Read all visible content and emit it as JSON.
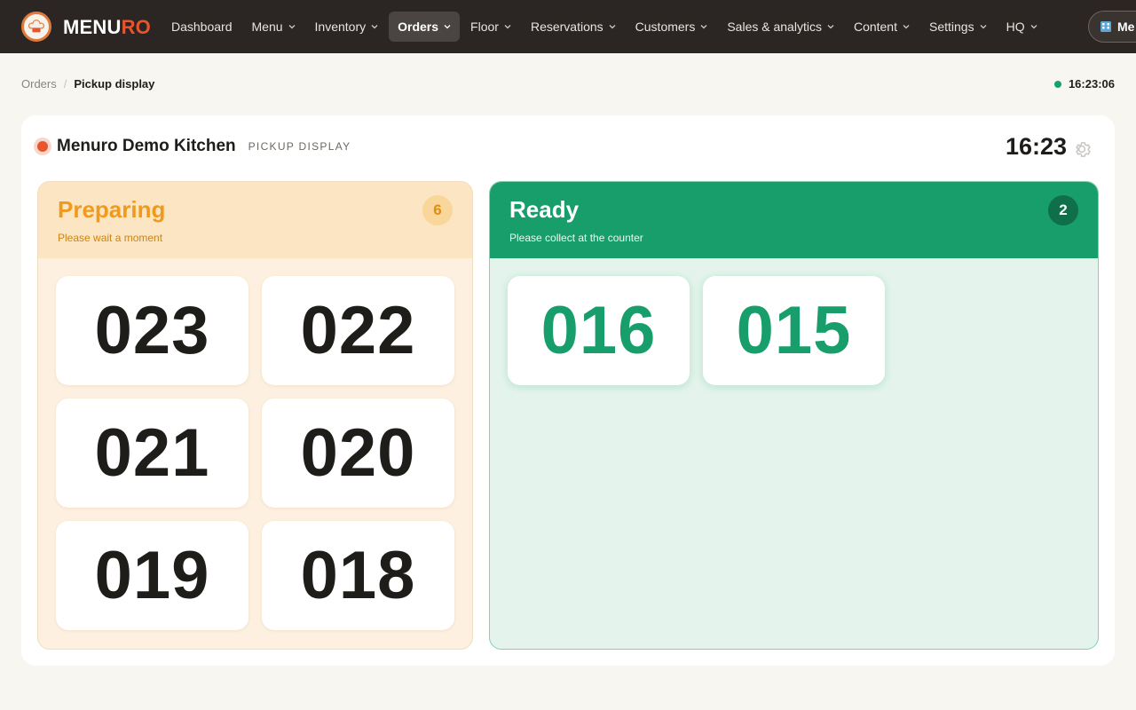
{
  "app": {
    "brand_main": "MENU",
    "brand_accent": "RO",
    "nav": [
      {
        "label": "Dashboard",
        "has_dropdown": false,
        "active": false
      },
      {
        "label": "Menu",
        "has_dropdown": true,
        "active": false
      },
      {
        "label": "Inventory",
        "has_dropdown": true,
        "active": false
      },
      {
        "label": "Orders",
        "has_dropdown": true,
        "active": true
      },
      {
        "label": "Floor",
        "has_dropdown": true,
        "active": false
      },
      {
        "label": "Reservations",
        "has_dropdown": true,
        "active": false
      },
      {
        "label": "Customers",
        "has_dropdown": true,
        "active": false
      },
      {
        "label": "Sales & analytics",
        "has_dropdown": true,
        "active": false
      },
      {
        "label": "Content",
        "has_dropdown": true,
        "active": false
      },
      {
        "label": "Settings",
        "has_dropdown": true,
        "active": false
      },
      {
        "label": "HQ",
        "has_dropdown": true,
        "active": false
      }
    ],
    "store_pill": "Me"
  },
  "breadcrumb": {
    "parent": "Orders",
    "current": "Pickup display"
  },
  "status": {
    "clock": "16:23:06",
    "online_color": "#17a06b"
  },
  "display": {
    "kitchen_name": "Menuro Demo Kitchen",
    "mode_label": "PICKUP DISPLAY",
    "time": "16:23"
  },
  "preparing": {
    "title": "Preparing",
    "subtitle": "Please wait a moment",
    "count": "6",
    "orders": [
      "023",
      "022",
      "021",
      "020",
      "019",
      "018"
    ]
  },
  "ready": {
    "title": "Ready",
    "subtitle": "Please collect at the counter",
    "count": "2",
    "orders": [
      "016",
      "015"
    ]
  },
  "colors": {
    "topbar": "#2b2623",
    "brand_accent": "#e8552c",
    "preparing_accent": "#ef9a1d",
    "ready_accent": "#179e6b"
  }
}
